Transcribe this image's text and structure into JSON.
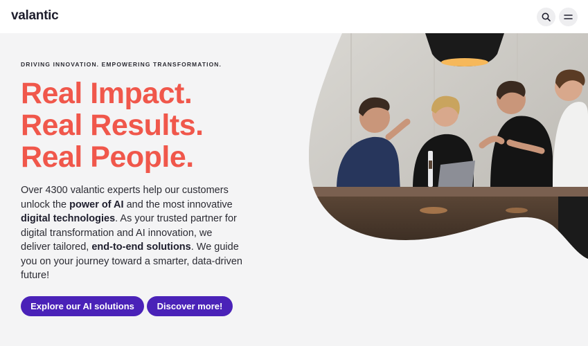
{
  "header": {
    "logo_text": "valantic",
    "search_icon": "search-icon",
    "menu_icon": "hamburger-menu-icon"
  },
  "hero": {
    "eyebrow": "DRIVING INNOVATION. EMPOWERING TRANSFORMATION.",
    "headline_lines": [
      "Real Impact.",
      "Real Results.",
      "Real People."
    ],
    "body": {
      "t1": "Over 4300 valantic experts help our customers unlock the ",
      "b1": "power of AI",
      "t2": " and the most innovative ",
      "b2": "digital technologies",
      "t3": ". As your trusted partner for digital transformation and AI innovation, we deliver tailored, ",
      "b3": "end-to-end solutions",
      "t4": ". We guide you on your journey toward a smarter, data-driven future!"
    },
    "buttons": {
      "primary": "Explore our AI solutions",
      "secondary": "Discover more!"
    }
  },
  "colors": {
    "accent_headline": "#f0574b",
    "button": "#4a22b8",
    "background": "#f4f4f5"
  }
}
